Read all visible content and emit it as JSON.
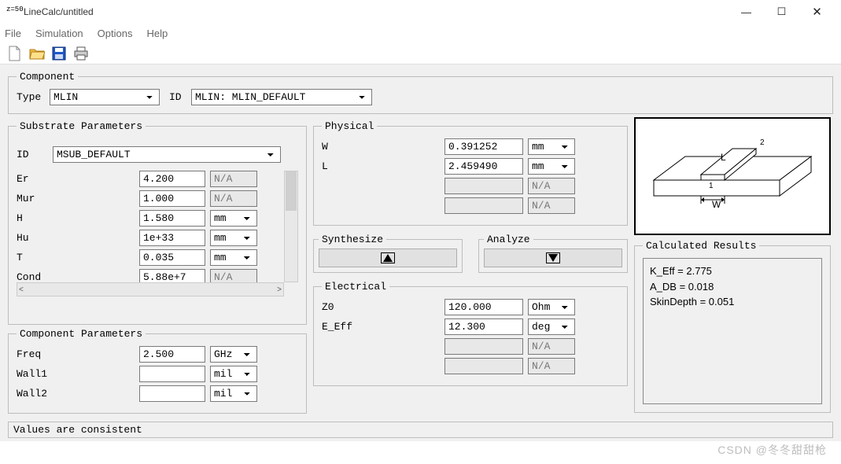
{
  "window": {
    "appicon_text": "z=50",
    "title": "LineCalc/untitled",
    "minimize": "—",
    "maximize": "☐",
    "close": "✕"
  },
  "menu": {
    "file": "File",
    "simulation": "Simulation",
    "options": "Options",
    "help": "Help"
  },
  "component": {
    "legend": "Component",
    "type_label": "Type",
    "type_value": "MLIN",
    "id_label": "ID",
    "id_value": "MLIN: MLIN_DEFAULT"
  },
  "substrate": {
    "legend": "Substrate Parameters",
    "id_label": "ID",
    "id_value": "MSUB_DEFAULT",
    "rows": [
      {
        "name": "Er",
        "value": "4.200",
        "unit": "N/A",
        "unit_disabled": true
      },
      {
        "name": "Mur",
        "value": "1.000",
        "unit": "N/A",
        "unit_disabled": true
      },
      {
        "name": "H",
        "value": "1.580",
        "unit": "mm",
        "unit_disabled": false
      },
      {
        "name": "Hu",
        "value": "1e+33",
        "unit": "mm",
        "unit_disabled": false
      },
      {
        "name": "T",
        "value": "0.035",
        "unit": "mm",
        "unit_disabled": false
      },
      {
        "name": "Cond",
        "value": "5.88e+7",
        "unit": "N/A",
        "unit_disabled": true
      }
    ]
  },
  "comp_params": {
    "legend": "Component Parameters",
    "rows": [
      {
        "name": "Freq",
        "value": "2.500",
        "unit": "GHz"
      },
      {
        "name": "Wall1",
        "value": "",
        "unit": "mil"
      },
      {
        "name": "Wall2",
        "value": "",
        "unit": "mil"
      }
    ]
  },
  "physical": {
    "legend": "Physical",
    "rows": [
      {
        "name": "W",
        "value": "0.391252",
        "unit": "mm",
        "unit_disabled": false
      },
      {
        "name": "L",
        "value": "2.459490",
        "unit": "mm",
        "unit_disabled": false
      },
      {
        "name": "",
        "value": "",
        "unit": "N/A",
        "unit_disabled": true
      },
      {
        "name": "",
        "value": "",
        "unit": "N/A",
        "unit_disabled": true
      }
    ]
  },
  "synthesize": {
    "legend": "Synthesize"
  },
  "analyze": {
    "legend": "Analyze"
  },
  "electrical": {
    "legend": "Electrical",
    "rows": [
      {
        "name": "Z0",
        "value": "120.000",
        "unit": "Ohm",
        "unit_disabled": false
      },
      {
        "name": "E_Eff",
        "value": "12.300",
        "unit": "deg",
        "unit_disabled": false
      },
      {
        "name": "",
        "value": "",
        "unit": "N/A",
        "unit_disabled": true
      },
      {
        "name": "",
        "value": "",
        "unit": "N/A",
        "unit_disabled": true
      }
    ]
  },
  "results": {
    "legend": "Calculated Results",
    "lines": [
      "K_Eff = 2.775",
      "A_DB = 0.018",
      "SkinDepth = 0.051"
    ]
  },
  "status": "Values are consistent",
  "watermark": "CSDN @冬冬甜甜枪",
  "scroll": {
    "left": "<",
    "right": ">"
  },
  "diagram_labels": {
    "L": "L",
    "W": "W",
    "one": "1",
    "two": "2"
  }
}
